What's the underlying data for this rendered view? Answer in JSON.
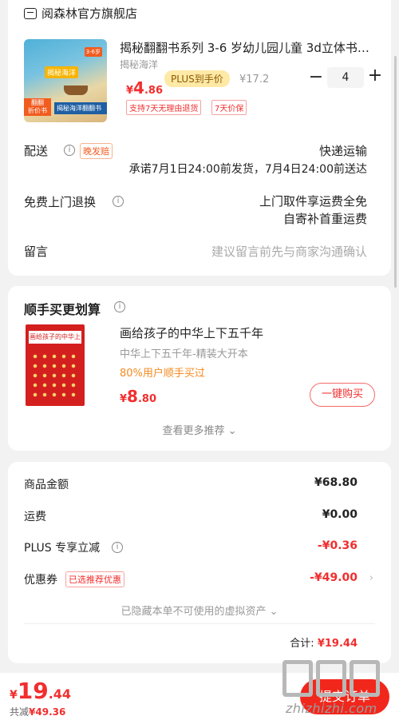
{
  "store": {
    "name": "阅森林官方旗舰店"
  },
  "product": {
    "title": "揭秘翻翻书系列 3-6 岁幼儿园儿童 3d立体书…",
    "subtitle": "揭秘海洋",
    "price_symbol": "¥",
    "price_int": "4",
    "price_dec": ".86",
    "plus_label": "PLUS到手价",
    "orig_price": "¥17.2",
    "quantity": "4",
    "minus": "−",
    "plus": "+",
    "services": [
      "支持7天无理由退货",
      "7天价保"
    ],
    "thumb": {
      "title": "揭秘海洋",
      "badge": "翻翻\n折价书",
      "bottom": "揭秘海洋翻翻书",
      "tag": "3-6岁"
    }
  },
  "delivery": {
    "label": "配送",
    "late_tag": "晚发赔",
    "method": "快递运输",
    "promise": "承诺7月1日24:00前发货，7月4日24:00前送达"
  },
  "returns": {
    "label": "免费上门退换",
    "line1": "上门取件享运费全免",
    "line2": "自寄补首重运费"
  },
  "message": {
    "label": "留言",
    "placeholder": "建议留言前先与商家沟通确认"
  },
  "recommend": {
    "title": "顺手买更划算",
    "item_name": "画给孩子的中华上下五千年",
    "item_sub": "中华上下五千年-精装大开本",
    "item_pct": "80%用户顺手买过",
    "price_symbol": "¥",
    "price_int": "8",
    "price_dec": ".80",
    "buy_label": "一键购买",
    "more_label": "查看更多推荐",
    "thumb_band": "画给孩子的中华上下五千年"
  },
  "totals": {
    "goods_label": "商品金额",
    "goods_value": "¥68.80",
    "shipping_label": "运费",
    "shipping_value": "¥0.00",
    "plus_label": "PLUS 专享立减",
    "plus_value": "-¥0.36",
    "coupon_label": "优惠券",
    "coupon_tag": "已选推荐优惠",
    "coupon_value": "-¥49.00",
    "hidden_assets": "已隐藏本单不可使用的虚拟资产",
    "subtotal_label": "合计:",
    "subtotal_value": "¥19.44"
  },
  "bottom": {
    "price_symbol": "¥",
    "price_int": "19",
    "price_dec": ".44",
    "save_label": "共减",
    "save_value": "¥49.36",
    "submit_label": "提交订单"
  },
  "watermark": {
    "text": "zhizhizhi.com"
  },
  "colors": {
    "accent": "#f22e2e",
    "submit": "#f2271c",
    "plus_tag_bg": "#ffe9a6"
  }
}
